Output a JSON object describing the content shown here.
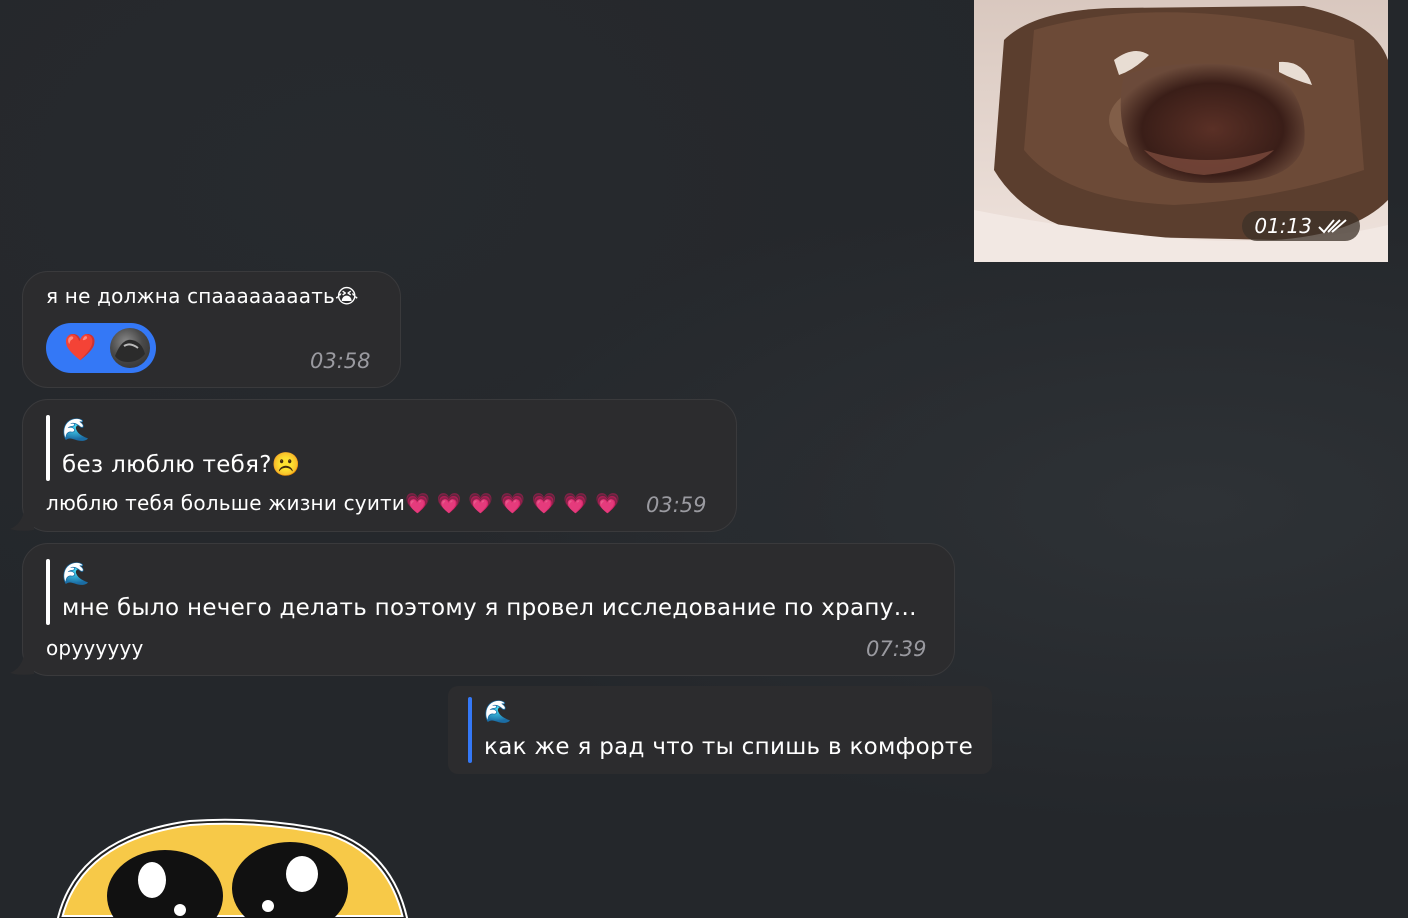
{
  "photo": {
    "time": "01:13",
    "status_icon": "double-check-icon"
  },
  "messages": [
    {
      "text": "я не должна спаааааааать😭",
      "time": "03:58",
      "reaction": {
        "emoji": "❤️",
        "icon": "heart-icon"
      }
    },
    {
      "reply_name": "🌊",
      "reply_text": "без люблю тебя?☹️",
      "text": "люблю тебя больше жизни суити💗 💗 💗 💗 💗 💗 💗",
      "time": "03:59"
    },
    {
      "reply_name": "🌊",
      "reply_text": "мне было нечего делать поэтому я провел исследование по храпу…",
      "text": "оруууууу",
      "time": "07:39"
    }
  ],
  "outgoing": {
    "reply_name": "🌊",
    "reply_text": "как же я рад что ты спишь в комфорте"
  },
  "colors": {
    "background": "#24272b",
    "bubble": "#2c2c2e",
    "accent": "#3478f6",
    "reply_bar_out": "#3478f6"
  }
}
